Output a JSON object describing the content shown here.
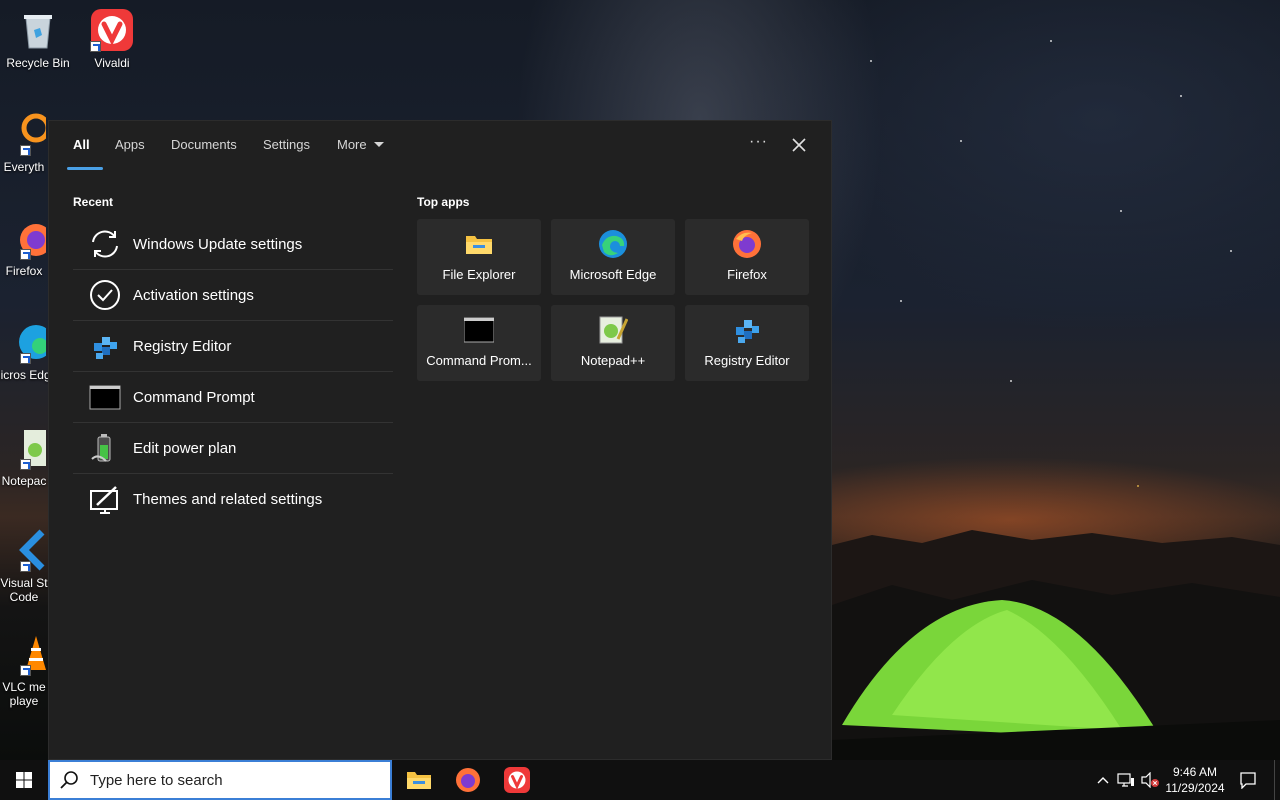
{
  "desktop": {
    "icons": [
      {
        "label": "Recycle Bin",
        "icon": "recycle-bin-icon"
      },
      {
        "label": "Vivaldi",
        "icon": "vivaldi-icon"
      },
      {
        "label": "Everyth",
        "icon": "everything-icon"
      },
      {
        "label": "Firefox",
        "icon": "firefox-icon"
      },
      {
        "label": "Micros Edge",
        "icon": "edge-icon"
      },
      {
        "label": "Notepac",
        "icon": "notepadpp-icon"
      },
      {
        "label": "Visual St Code",
        "icon": "vscode-icon"
      },
      {
        "label": "VLC me playe",
        "icon": "vlc-icon"
      }
    ]
  },
  "search_panel": {
    "tabs": [
      {
        "label": "All",
        "active": true
      },
      {
        "label": "Apps"
      },
      {
        "label": "Documents"
      },
      {
        "label": "Settings"
      },
      {
        "label": "More"
      }
    ],
    "recent_title": "Recent",
    "recent": [
      {
        "label": "Windows Update settings",
        "icon": "sync-icon"
      },
      {
        "label": "Activation settings",
        "icon": "check-circle-icon"
      },
      {
        "label": "Registry Editor",
        "icon": "registry-editor-icon"
      },
      {
        "label": "Command Prompt",
        "icon": "command-prompt-icon"
      },
      {
        "label": "Edit power plan",
        "icon": "battery-icon"
      },
      {
        "label": "Themes and related settings",
        "icon": "paint-monitor-icon"
      }
    ],
    "top_apps_title": "Top apps",
    "top_apps": [
      {
        "label": "File Explorer",
        "icon": "file-explorer-icon"
      },
      {
        "label": "Microsoft Edge",
        "icon": "edge-icon"
      },
      {
        "label": "Firefox",
        "icon": "firefox-icon"
      },
      {
        "label": "Command Prom...",
        "icon": "command-prompt-icon"
      },
      {
        "label": "Notepad++",
        "icon": "notepadpp-icon"
      },
      {
        "label": "Registry Editor",
        "icon": "registry-editor-icon"
      }
    ]
  },
  "taskbar": {
    "search_placeholder": "Type here to search",
    "pinned": [
      {
        "name": "File Explorer",
        "icon": "file-explorer-icon"
      },
      {
        "name": "Firefox",
        "icon": "firefox-icon"
      },
      {
        "name": "Vivaldi",
        "icon": "vivaldi-icon"
      }
    ],
    "time": "9:46 AM",
    "date": "11/29/2024"
  },
  "colors": {
    "accent": "#4aa0e6",
    "panel_bg": "#202020",
    "tile_bg": "#2b2b2b",
    "taskbar_bg": "#101010"
  }
}
